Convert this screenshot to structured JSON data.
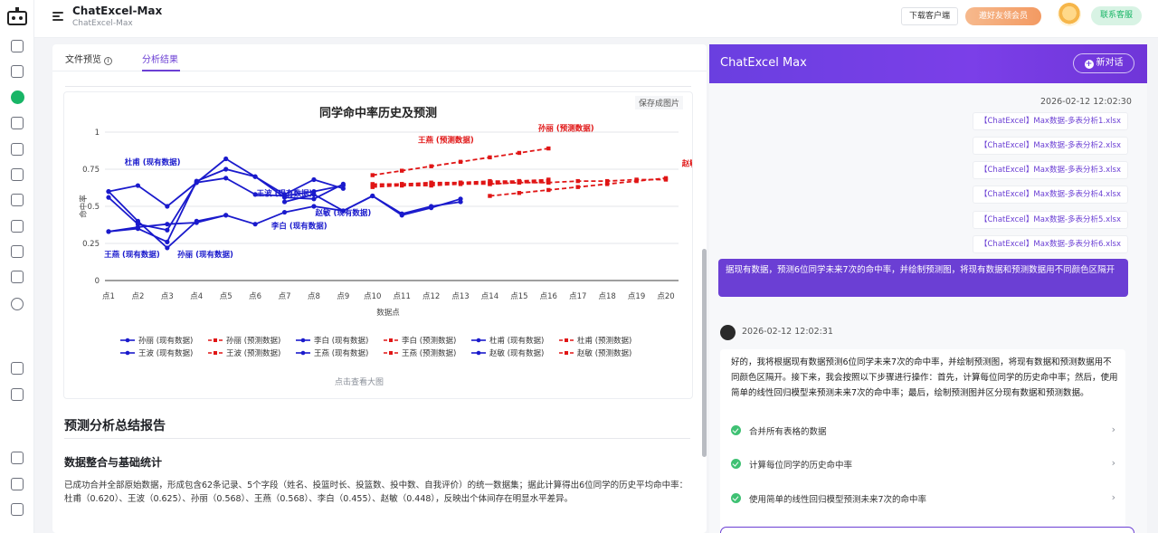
{
  "header": {
    "title": "ChatExcel-Max",
    "subtitle": "ChatExcel-Max",
    "download_label": "下载客户端",
    "promo_label": "邀好友领会员",
    "service_label": "联系客服"
  },
  "tabs": [
    {
      "label": "文件预览",
      "active": false
    },
    {
      "label": "分析结果",
      "active": true
    }
  ],
  "chart_panel": {
    "save_label": "保存成图片",
    "view_large_label": "点击查看大图"
  },
  "chart_data": {
    "type": "line",
    "title": "同学命中率历史及预测",
    "xlabel": "数据点",
    "ylabel": "命中率",
    "ylim": [
      0,
      1
    ],
    "yticks": [
      "0",
      "0.25",
      "0.5",
      "0.75",
      "1"
    ],
    "categories": [
      "点1",
      "点2",
      "点3",
      "点4",
      "点5",
      "点6",
      "点7",
      "点8",
      "点9",
      "点10",
      "点11",
      "点12",
      "点13",
      "点14",
      "点15",
      "点16",
      "点17",
      "点18",
      "点19",
      "点20"
    ],
    "grid": true,
    "legend_position": "bottom",
    "colors": {
      "history": "#1a1acc",
      "forecast": "#e01515"
    },
    "series": [
      {
        "name": "孙丽 (现有数据)",
        "kind": "history",
        "start": 0,
        "values": [
          0.6,
          0.4,
          0.22,
          0.4,
          0.44
        ]
      },
      {
        "name": "孙丽 (预测数据)",
        "kind": "forecast",
        "start": 9,
        "values": [
          0.71,
          0.74,
          0.77,
          0.8,
          0.83,
          0.86,
          0.89
        ]
      },
      {
        "name": "李白 (现有数据)",
        "kind": "history",
        "start": 0,
        "values": [
          0.33,
          0.36,
          0.38,
          0.39,
          0.44,
          0.38,
          0.46,
          0.5,
          0.47,
          0.57,
          0.45,
          0.5,
          0.53
        ]
      },
      {
        "name": "李白 (预测数据)",
        "kind": "forecast",
        "start": 13,
        "values": [
          0.57,
          0.59,
          0.61,
          0.63,
          0.65,
          0.67,
          0.69
        ]
      },
      {
        "name": "杜甫 (现有数据)",
        "kind": "history",
        "start": 0,
        "values": [
          0.6,
          0.64,
          0.5,
          0.66,
          0.82,
          0.7,
          0.56,
          0.55,
          0.65
        ]
      },
      {
        "name": "杜甫 (预测数据)",
        "kind": "forecast",
        "start": 9,
        "values": [
          0.63,
          0.64,
          0.64,
          0.65,
          0.65,
          0.66,
          0.66
        ]
      },
      {
        "name": "王波 (现有数据)",
        "kind": "history",
        "start": 0,
        "values": [
          0.56,
          0.38,
          0.34,
          0.66,
          0.69,
          0.58,
          0.57,
          0.6,
          0.64
        ]
      },
      {
        "name": "王波 (预测数据)",
        "kind": "forecast",
        "start": 9,
        "values": [
          0.64,
          0.65,
          0.65,
          0.66,
          0.66,
          0.67,
          0.67
        ]
      },
      {
        "name": "王燕 (现有数据)",
        "kind": "history",
        "start": 0,
        "values": [
          0.33,
          0.35,
          0.26,
          0.67,
          0.75,
          0.7,
          0.58,
          0.68,
          0.62
        ]
      },
      {
        "name": "王燕 (预测数据)",
        "kind": "forecast",
        "start": 9,
        "values": [
          0.65,
          0.65,
          0.66,
          0.66,
          0.67,
          0.67,
          0.68
        ]
      },
      {
        "name": "赵敏 (现有数据)",
        "kind": "history",
        "start": 6,
        "values": [
          0.53,
          0.58,
          0.47,
          0.57,
          0.44,
          0.49,
          0.55
        ]
      },
      {
        "name": "赵敏 (预测数据)",
        "kind": "forecast",
        "start": 13,
        "values": [
          0.65,
          0.66,
          0.66,
          0.67,
          0.67,
          0.68,
          0.68
        ]
      }
    ],
    "annotations": [
      {
        "text": "杜甫 (现有数据)",
        "kind": "history",
        "x": 1.5,
        "y": 0.78
      },
      {
        "text": "王波 (现有数据)",
        "kind": "history",
        "x": 6.0,
        "y": 0.57
      },
      {
        "text": "赵敏 (现有数据)",
        "kind": "history",
        "x": 8.0,
        "y": 0.44
      },
      {
        "text": "李白 (现有数据)",
        "kind": "history",
        "x": 6.5,
        "y": 0.35
      },
      {
        "text": "王燕 (现有数据)",
        "kind": "history",
        "x": 0.8,
        "y": 0.16
      },
      {
        "text": "孙丽 (现有数据)",
        "kind": "history",
        "x": 3.3,
        "y": 0.16
      },
      {
        "text": "王燕 (预测数据)",
        "kind": "forecast",
        "x": 11.5,
        "y": 0.93
      },
      {
        "text": "孙丽 (预测数据)",
        "kind": "forecast",
        "x": 15.6,
        "y": 1.01
      },
      {
        "text": "赵敏 (预测数据)",
        "kind": "forecast",
        "x": 20.5,
        "y": 0.77
      },
      {
        "text": "李白 (预测数据)",
        "kind": "forecast",
        "x": 21.1,
        "y": 0.59
      }
    ]
  },
  "report": {
    "title": "预测分析总结报告",
    "section_title": "数据整合与基础统计",
    "paragraph": "已成功合并全部原始数据，形成包含62条记录、5个字段（姓名、投篮时长、投篮数、投中数、自我评价）的统一数据集；据此计算得出6位同学的历史平均命中率：杜甫（0.620）、王波（0.625）、孙丽（0.568）、王燕（0.568）、李白（0.455）、赵敏（0.448），反映出个体间存在明显水平差异。"
  },
  "chat": {
    "title": "ChatExcel Max",
    "new_chat_label": "新对话",
    "user_timestamp": "2026-02-12 12:02:30",
    "files": [
      "【ChatExcel】Max数据-多表分析1.xlsx",
      "【ChatExcel】Max数据-多表分析2.xlsx",
      "【ChatExcel】Max数据-多表分析3.xlsx",
      "【ChatExcel】Max数据-多表分析4.xlsx",
      "【ChatExcel】Max数据-多表分析5.xlsx",
      "【ChatExcel】Max数据-多表分析6.xlsx"
    ],
    "user_message": "据现有数据，预测6位同学未来7次的命中率，并绘制预测图，将现有数据和预测数据用不同颜色区隔开",
    "bot_timestamp": "2026-02-12 12:02:31",
    "bot_message": "好的，我将根据现有数据预测6位同学未来7次的命中率，并绘制预测图，将现有数据和预测数据用不同颜色区隔开。接下来，我会按照以下步骤进行操作：首先，计算每位同学的历史命中率；然后，使用简单的线性回归模型来预测未来7次的命中率；最后，绘制预测图并区分现有数据和预测数据。",
    "steps": [
      "合并所有表格的数据",
      "计算每位同学的历史命中率",
      "使用简单的线性回归模型预测未来7次的命中率"
    ]
  }
}
